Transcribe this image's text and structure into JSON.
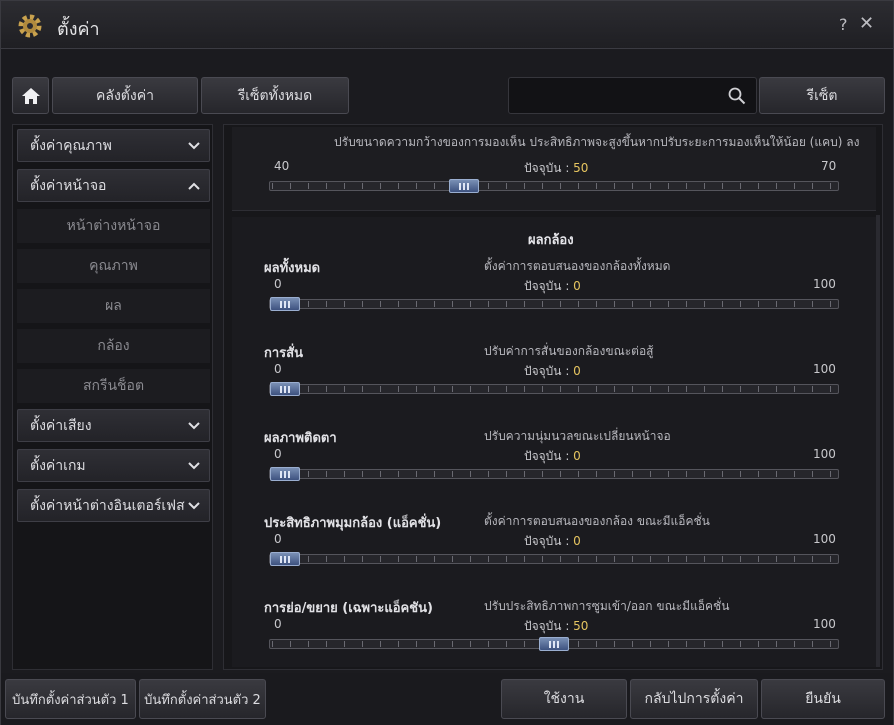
{
  "window": {
    "title": "ตั้งค่า",
    "help": "?",
    "close": "✕"
  },
  "toolbar": {
    "back_label": "คลังตั้งค่า",
    "reset_all_label": "รีเซ็ตทั้งหมด",
    "search_value": "",
    "reset_label": "รีเซ็ต"
  },
  "sidebar": {
    "categories": [
      {
        "label": "ตั้งค่าคุณภาพ",
        "expanded": false
      },
      {
        "label": "ตั้งค่าหน้าจอ",
        "expanded": true
      },
      {
        "label": "ตั้งค่าเสียง",
        "expanded": false
      },
      {
        "label": "ตั้งค่าเกม",
        "expanded": false
      },
      {
        "label": "ตั้งค่าหน้าต่างอินเตอร์เฟส",
        "expanded": false
      }
    ],
    "subitems": [
      "หน้าต่างหน้าจอ",
      "คุณภาพ",
      "ผล",
      "กล้อง",
      "สกรีนช็อต"
    ]
  },
  "view_range": {
    "desc": "ปรับขนาดความกว้างของการมองเห็น ประสิทธิภาพจะสูงขึ้นหากปรับระยะการมองเห็นให้น้อย (แคบ) ลง",
    "min": "40",
    "max": "70",
    "current_prefix": "ปัจจุบัน : ",
    "current": "50",
    "fraction": 0.333
  },
  "camera_section": {
    "heading": "ผลกล้อง",
    "items": [
      {
        "label": "ผลทั้งหมด",
        "desc": "ตั้งค่าการตอบสนองของกล้องทั้งหมด",
        "min": "0",
        "max": "100",
        "current_prefix": "ปัจจุบัน : ",
        "current": "0",
        "fraction": 0
      },
      {
        "label": "การสั่น",
        "desc": "ปรับค่าการสั่นของกล้องขณะต่อสู้",
        "min": "0",
        "max": "100",
        "current_prefix": "ปัจจุบัน : ",
        "current": "0",
        "fraction": 0
      },
      {
        "label": "ผลภาพติดตา",
        "desc": "ปรับความนุ่มนวลขณะเปลี่ยนหน้าจอ",
        "min": "0",
        "max": "100",
        "current_prefix": "ปัจจุบัน : ",
        "current": "0",
        "fraction": 0
      },
      {
        "label": "ประสิทธิภาพมุมกล้อง (แอ็คชั่น)",
        "desc": "ตั้งค่าการตอบสนองของกล้อง ขณะมีแอ็คชั่น",
        "min": "0",
        "max": "100",
        "current_prefix": "ปัจจุบัน : ",
        "current": "0",
        "fraction": 0
      },
      {
        "label": "การย่อ/ขยาย (เฉพาะแอ็คชัน)",
        "desc": "ปรับประสิทธิภาพการซูมเข้า/ออก ขณะมีแอ็คชั่น",
        "min": "0",
        "max": "100",
        "current_prefix": "ปัจจุบัน : ",
        "current": "50",
        "fraction": 0.5
      }
    ]
  },
  "footer": {
    "save1": "บันทึกตั้งค่าส่วนตัว 1",
    "save2": "บันทึกตั้งค่าส่วนตัว 2",
    "apply": "ใช้งาน",
    "revert": "กลับไปการตั้งค่า",
    "confirm": "ยืนยัน"
  },
  "colors": {
    "accent": "#e6c560",
    "thumb": "#5a6f9a"
  }
}
